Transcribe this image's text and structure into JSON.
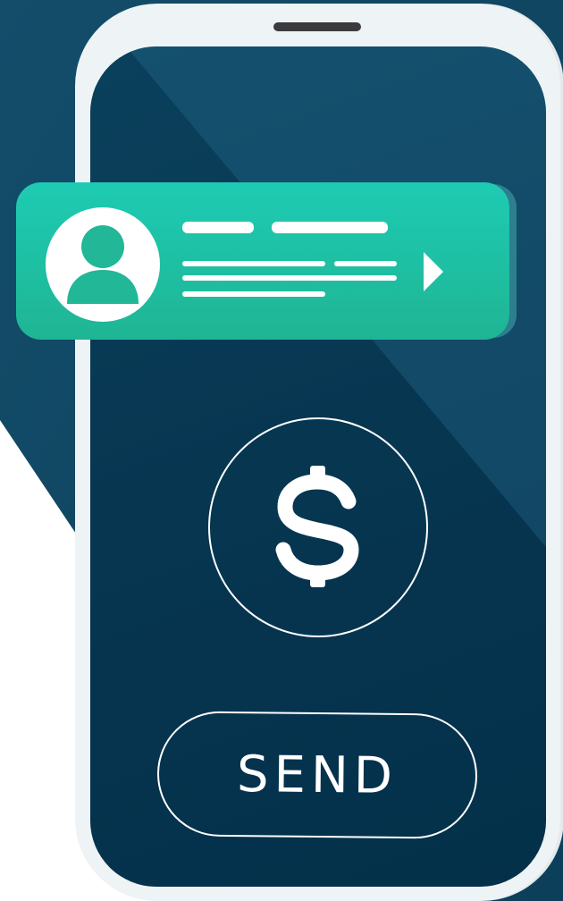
{
  "send_button": {
    "label": "SEND"
  },
  "currency_icon": "dollar-icon",
  "notification": {
    "avatar_icon": "user-icon",
    "arrow_icon": "play-arrow-icon"
  },
  "colors": {
    "background_dark": "#0f4a67",
    "screen": "#05314a",
    "notification": "#1ecbb3",
    "phone_frame": "#eef3f5",
    "text": "#ffffff"
  }
}
